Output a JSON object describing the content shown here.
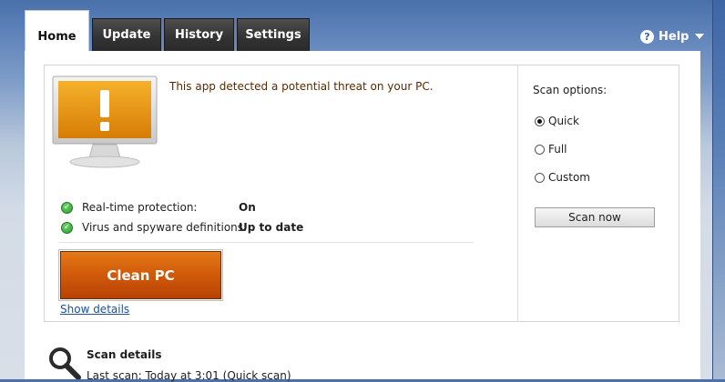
{
  "tabs": [
    {
      "label": "Home",
      "active": true
    },
    {
      "label": "Update",
      "active": false
    },
    {
      "label": "History",
      "active": false
    },
    {
      "label": "Settings",
      "active": false
    }
  ],
  "help": {
    "label": "Help",
    "icon": "help-icon"
  },
  "status": {
    "message": "This app detected a potential threat on your PC.",
    "rows": [
      {
        "label": "Real-time protection:",
        "value": "On"
      },
      {
        "label": "Virus and spyware definitions:",
        "value": "Up to date"
      }
    ]
  },
  "actions": {
    "clean_label": "Clean PC",
    "show_details": "Show details"
  },
  "scan_options": {
    "title": "Scan options:",
    "options": [
      {
        "label": "Quick",
        "selected": true
      },
      {
        "label": "Full",
        "selected": false
      },
      {
        "label": "Custom",
        "selected": false
      }
    ],
    "scan_now_label": "Scan now"
  },
  "scan_details": {
    "title": "Scan details",
    "last_scan": "Last scan:  Today at 3:01 (Quick scan)"
  },
  "colors": {
    "accent_orange": "#d25c0a",
    "ok_green": "#2b9a2b",
    "link_blue": "#1b4f9f"
  }
}
